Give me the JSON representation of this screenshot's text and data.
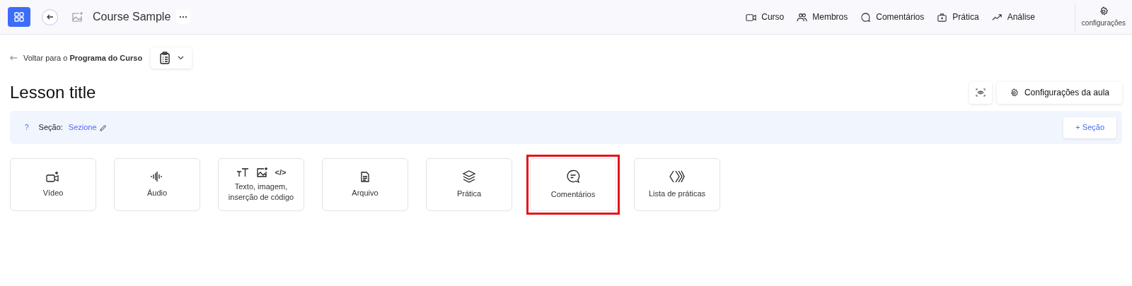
{
  "header": {
    "course_title": "Course Sample",
    "more": "···",
    "nav": [
      {
        "label": "Curso",
        "kind": "video"
      },
      {
        "label": "Membros",
        "kind": "users"
      },
      {
        "label": "Comentários",
        "kind": "chat"
      },
      {
        "label": "Prática",
        "kind": "briefcase"
      },
      {
        "label": "Análise",
        "kind": "trend"
      }
    ],
    "settings": "configurações"
  },
  "back_link": {
    "prefix": "Voltar para o ",
    "target": "Programa do Curso"
  },
  "lesson_title": "Lesson title",
  "actions": {
    "settings_button": "Configurações da aula"
  },
  "section": {
    "help": "?",
    "label": "Seção:",
    "name": "Sezione",
    "add_button": "+ Seção"
  },
  "tiles": [
    {
      "label": "Vídeo",
      "kind": "video",
      "highlighted": false
    },
    {
      "label": "Áudio",
      "kind": "audio",
      "highlighted": false
    },
    {
      "label": "Texto, imagem, inserção de código",
      "kind": "rich",
      "code_glyph": "</>",
      "highlighted": false
    },
    {
      "label": "Arquivo",
      "kind": "file",
      "highlighted": false
    },
    {
      "label": "Prática",
      "kind": "layers",
      "highlighted": false
    },
    {
      "label": "Comentários",
      "kind": "comment",
      "highlighted": true
    },
    {
      "label": "Lista de práticas",
      "kind": "list",
      "highlighted": false
    }
  ]
}
